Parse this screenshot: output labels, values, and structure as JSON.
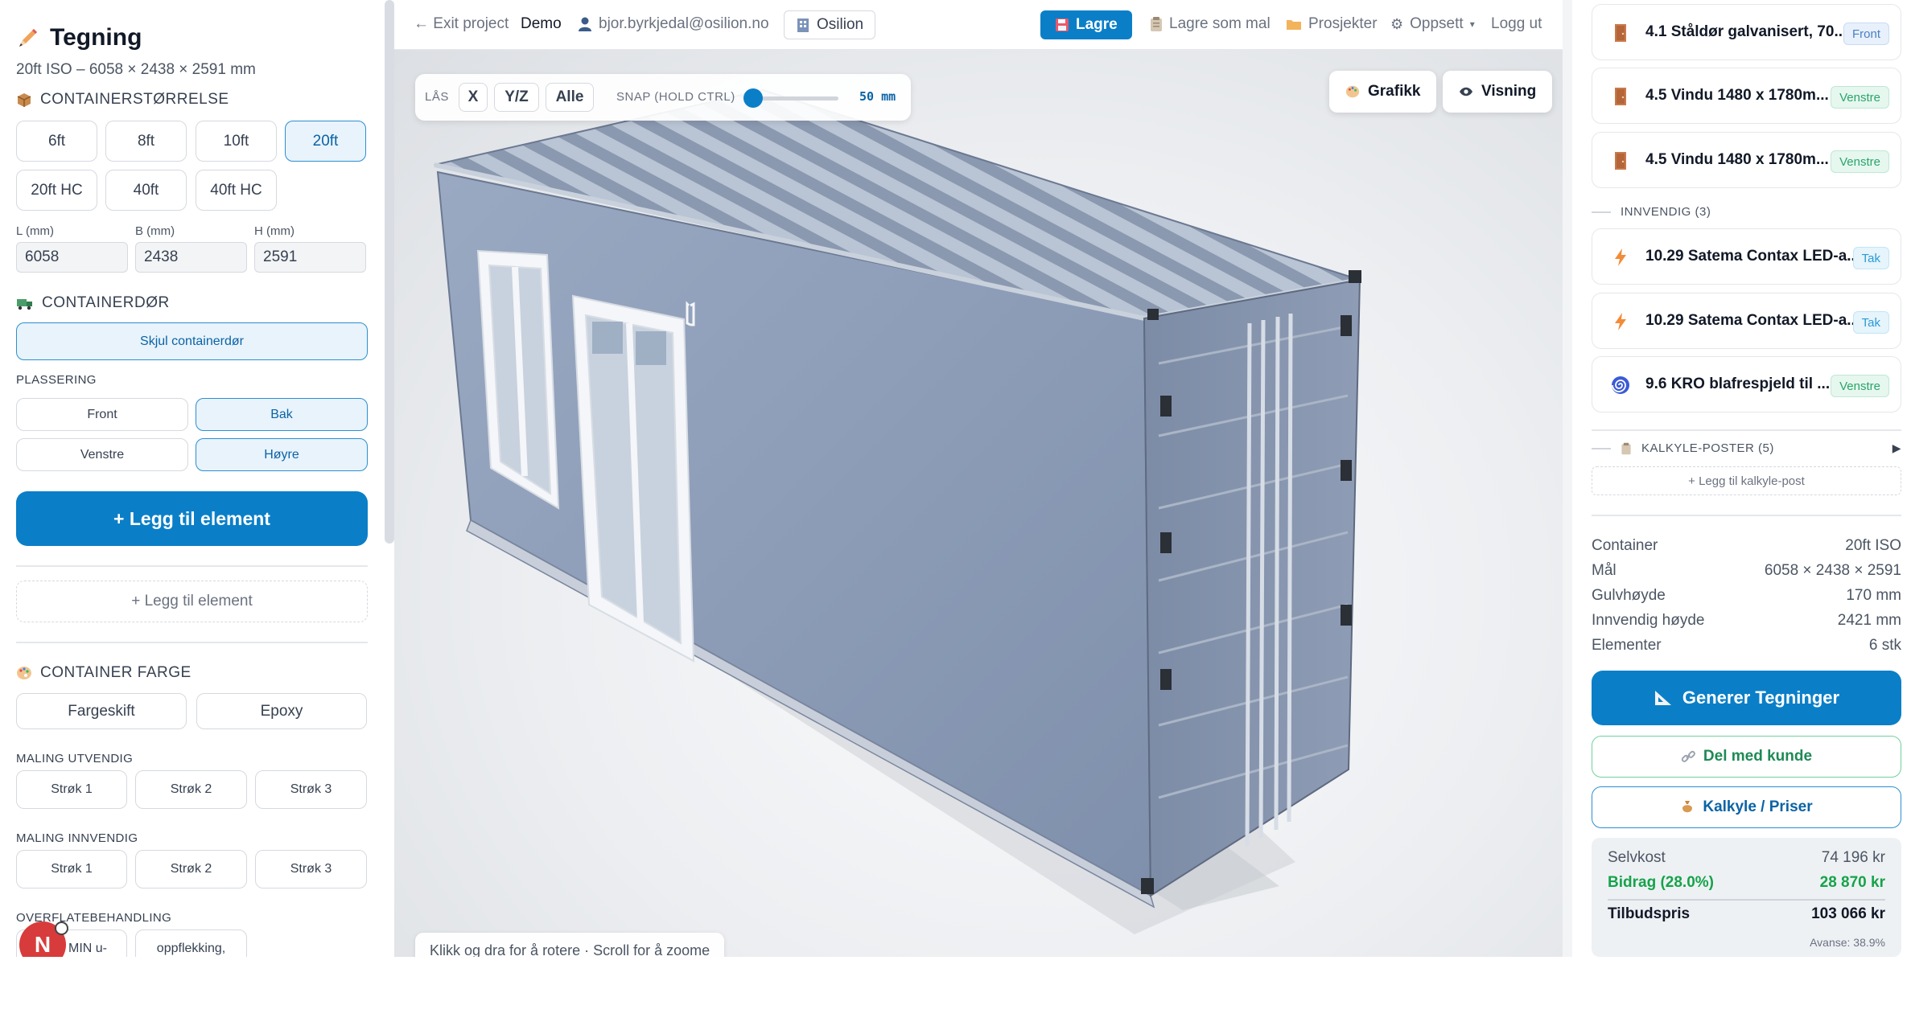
{
  "left": {
    "title": "Tegning",
    "subtitle": "20ft ISO – 6058 × 2438 × 2591 mm",
    "size_section": "CONTAINERSTØRRELSE",
    "sizes": [
      "6ft",
      "8ft",
      "10ft",
      "20ft",
      "20ft HC",
      "40ft",
      "40ft HC"
    ],
    "selected_size": "20ft",
    "dims": {
      "l_label": "L (mm)",
      "l_value": "6058",
      "b_label": "B (mm)",
      "b_value": "2438",
      "h_label": "H (mm)",
      "h_value": "2591"
    },
    "door_section": "CONTAINERDØR",
    "hide_door": "Skjul containerdør",
    "placement_label": "PLASSERING",
    "placements": [
      "Front",
      "Bak",
      "Venstre",
      "Høyre"
    ],
    "selected_placements": [
      "Bak",
      "Høyre"
    ],
    "add_element_primary": "+ Legg til element",
    "add_element_secondary": "+ Legg til element",
    "color_section": "CONTAINER FARGE",
    "color_options": [
      "Fargeskift",
      "Epoxy"
    ],
    "paint_outside_label": "MALING UTVENDIG",
    "paint_inside_label": "MALING INNVENDIG",
    "coats": [
      "Strøk 1",
      "Strøk 2",
      "Strøk 3"
    ],
    "surface_label": "OVERFLATEBEHANDLING",
    "surface_options": [
      "MIN u-",
      "oppflekking,"
    ],
    "avatar_letter": "N"
  },
  "topbar": {
    "exit": "← Exit project",
    "project": "Demo",
    "user": "bjor.byrkjedal@osilion.no",
    "org": "Osilion",
    "save": "Lagre",
    "save_template": "Lagre som mal",
    "projects": "Prosjekter",
    "setup": "Oppsett",
    "logout": "Logg ut"
  },
  "viewport": {
    "lock_label": "LÅS",
    "lock_buttons": [
      "X",
      "Y/Z",
      "Alle"
    ],
    "snap_label": "SNAP (HOLD CTRL)",
    "snap_value": "50 mm",
    "graphics": "Grafikk",
    "view": "Visning",
    "hint": "Klikk og dra for å rotere · Scroll for å zoome"
  },
  "right": {
    "cards_top": [
      {
        "name": "4.1 Ståldør galvanisert, 70...",
        "badge": "Front",
        "badge_type": "front",
        "icon": "door-icon"
      },
      {
        "name": "4.5 Vindu 1480 x 1780m...",
        "badge": "Venstre",
        "badge_type": "left",
        "icon": "door-icon"
      },
      {
        "name": "4.5 Vindu 1480 x 1780m...",
        "badge": "Venstre",
        "badge_type": "left",
        "icon": "door-icon"
      }
    ],
    "interior_label": "INNVENDIG (3)",
    "cards_interior": [
      {
        "name": "10.29 Satema Contax LED-a...",
        "badge": "Tak",
        "badge_type": "roof",
        "icon": "lightning-icon"
      },
      {
        "name": "10.29 Satema Contax LED-a...",
        "badge": "Tak",
        "badge_type": "roof",
        "icon": "lightning-icon"
      },
      {
        "name": "9.6 KRO blafrespjeld til ...",
        "badge": "Venstre",
        "badge_type": "left",
        "icon": "spiral-icon"
      }
    ],
    "calc_label": "KALKYLE-POSTER (5)",
    "add_calc": "+ Legg til kalkyle-post",
    "info": [
      {
        "label": "Container",
        "value": "20ft ISO"
      },
      {
        "label": "Mål",
        "value": "6058 × 2438 × 2591"
      },
      {
        "label": "Gulvhøyde",
        "value": "170 mm"
      },
      {
        "label": "Innvendig høyde",
        "value": "2421 mm"
      },
      {
        "label": "Elementer",
        "value": "6 stk"
      }
    ],
    "generate": "Generer Tegninger",
    "share": "Del med kunde",
    "calc": "Kalkyle / Priser",
    "pricing": {
      "cost_label": "Selvkost",
      "cost_value": "74 196 kr",
      "margin_label": "Bidrag (28.0%)",
      "margin_value": "28 870 kr",
      "offer_label": "Tilbudspris",
      "offer_value": "103 066 kr",
      "markup": "Avanse: 38.9%"
    }
  },
  "colors": {
    "accent": "#0a7fc8",
    "container": "#8f9fb9",
    "green": "#16a34a"
  }
}
